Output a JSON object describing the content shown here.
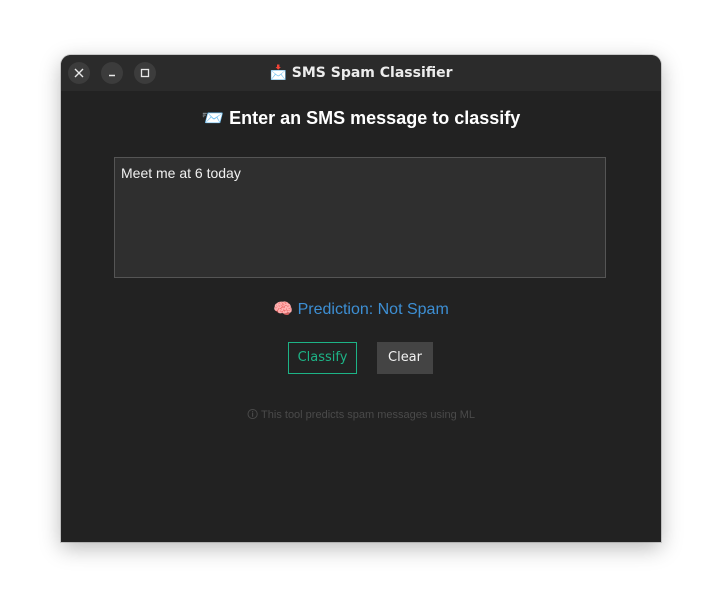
{
  "window": {
    "title": "📩 SMS Spam Classifier",
    "controls": {
      "close": "close",
      "minimize": "minimize",
      "maximize": "maximize"
    }
  },
  "main": {
    "heading": "📨 Enter an SMS message to classify",
    "message_value": "Meet me at 6 today",
    "prediction": "🧠 Prediction: Not Spam",
    "classify_label": "Classify",
    "clear_label": "Clear",
    "footer": "🛈 This tool predicts spam messages using ML"
  },
  "colors": {
    "background": "#222222",
    "titlebar": "#2b2b2b",
    "prediction_text": "#3d8fd4",
    "classify_accent": "#1db386",
    "clear_button": "#444444"
  }
}
